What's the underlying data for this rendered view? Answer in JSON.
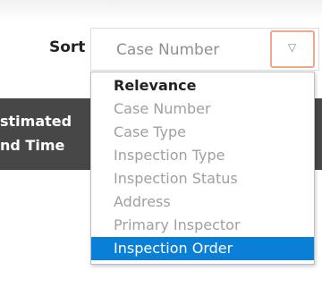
{
  "sort": {
    "label": "Sort",
    "current_value": "Case Number"
  },
  "background_bar": {
    "line1": "stimated",
    "line2": "nd Time"
  },
  "dropdown": {
    "options": [
      "Relevance",
      "Case Number",
      "Case Type",
      "Inspection Type",
      "Inspection Status",
      "Address",
      "Primary Inspector",
      "Inspection Order"
    ],
    "bold_option": "Relevance",
    "highlighted_option": "Inspection Order"
  },
  "icons": {
    "dropdown_arrow": "chevron-down-icon"
  },
  "colors": {
    "highlight": "#0a7fd8",
    "focus_border": "#f2a78d",
    "dark_bar": "#474747"
  }
}
